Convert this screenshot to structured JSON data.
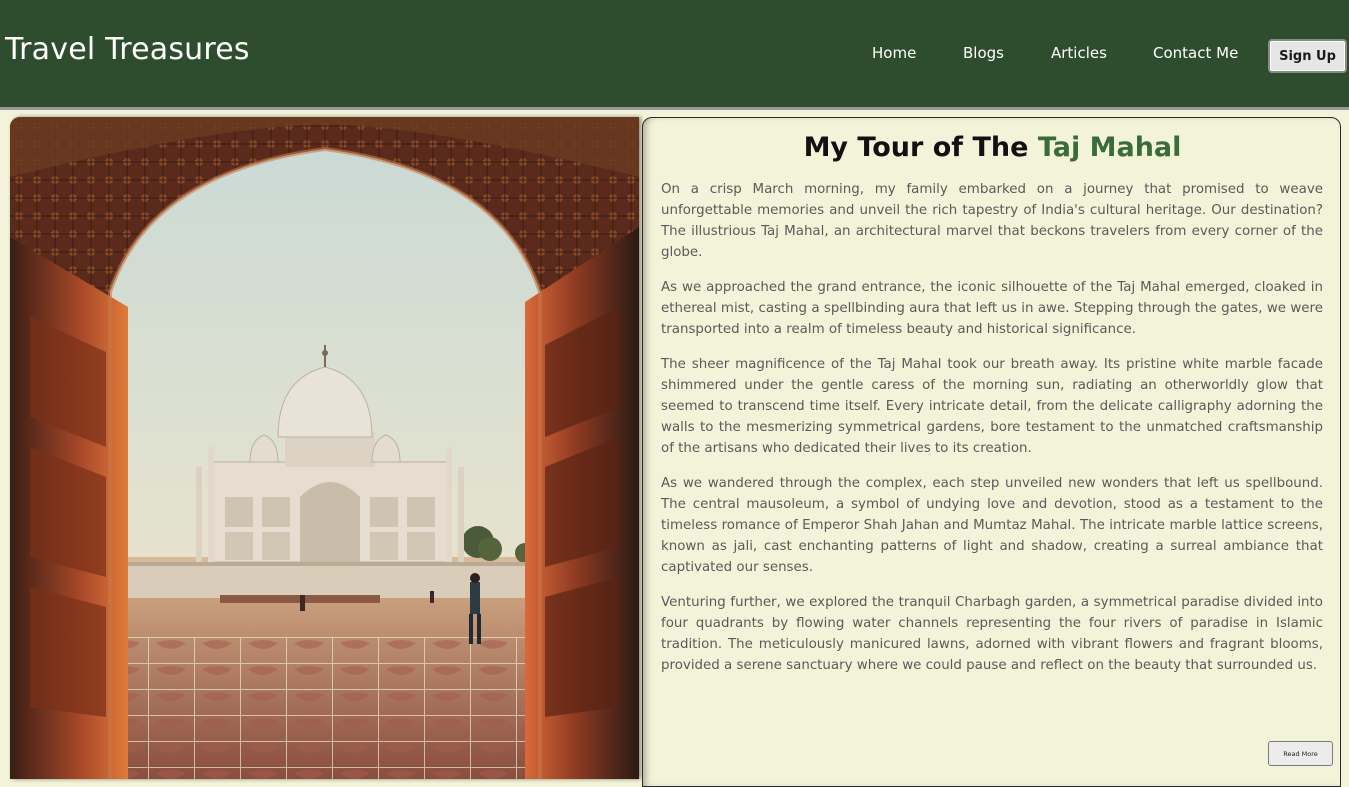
{
  "header": {
    "brand": "Travel Treasures",
    "nav": [
      {
        "label": "Home"
      },
      {
        "label": "Blogs"
      },
      {
        "label": "Articles"
      },
      {
        "label": "Contact Me"
      }
    ],
    "signup_label": "Sign Up"
  },
  "article": {
    "title_prefix": "My Tour of The",
    "title_accent": "Taj Mahal",
    "paragraphs": [
      "On a crisp March morning, my family embarked on a journey that promised to weave unforgettable memories and unveil the rich tapestry of India's cultural heritage. Our destination? The illustrious Taj Mahal, an architectural marvel that beckons travelers from every corner of the globe.",
      "As we approached the grand entrance, the iconic silhouette of the Taj Mahal emerged, cloaked in ethereal mist, casting a spellbinding aura that left us in awe. Stepping through the gates, we were transported into a realm of timeless beauty and historical significance.",
      "The sheer magnificence of the Taj Mahal took our breath away. Its pristine white marble facade shimmered under the gentle caress of the morning sun, radiating an otherworldly glow that seemed to transcend time itself. Every intricate detail, from the delicate calligraphy adorning the walls to the mesmerizing symmetrical gardens, bore testament to the unmatched craftsmanship of the artisans who dedicated their lives to its creation.",
      "As we wandered through the complex, each step unveiled new wonders that left us spellbound. The central mausoleum, a symbol of undying love and devotion, stood as a testament to the timeless romance of Emperor Shah Jahan and Mumtaz Mahal. The intricate marble lattice screens, known as jali, cast enchanting patterns of light and shadow, creating a surreal ambiance that captivated our senses.",
      "Venturing further, we explored the tranquil Charbagh garden, a symmetrical paradise divided into four quadrants by flowing water channels representing the four rivers of paradise in Islamic tradition. The meticulously manicured lawns, adorned with vibrant flowers and fragrant blooms, provided a serene sanctuary where we could pause and reflect on the beauty that surrounded us."
    ],
    "read_more_label": "Read More"
  },
  "colors": {
    "header_bg": "#2e4d2e",
    "page_bg": "#f3f3d9",
    "accent": "#3a6b3a",
    "body_text": "#5a5a5a"
  }
}
